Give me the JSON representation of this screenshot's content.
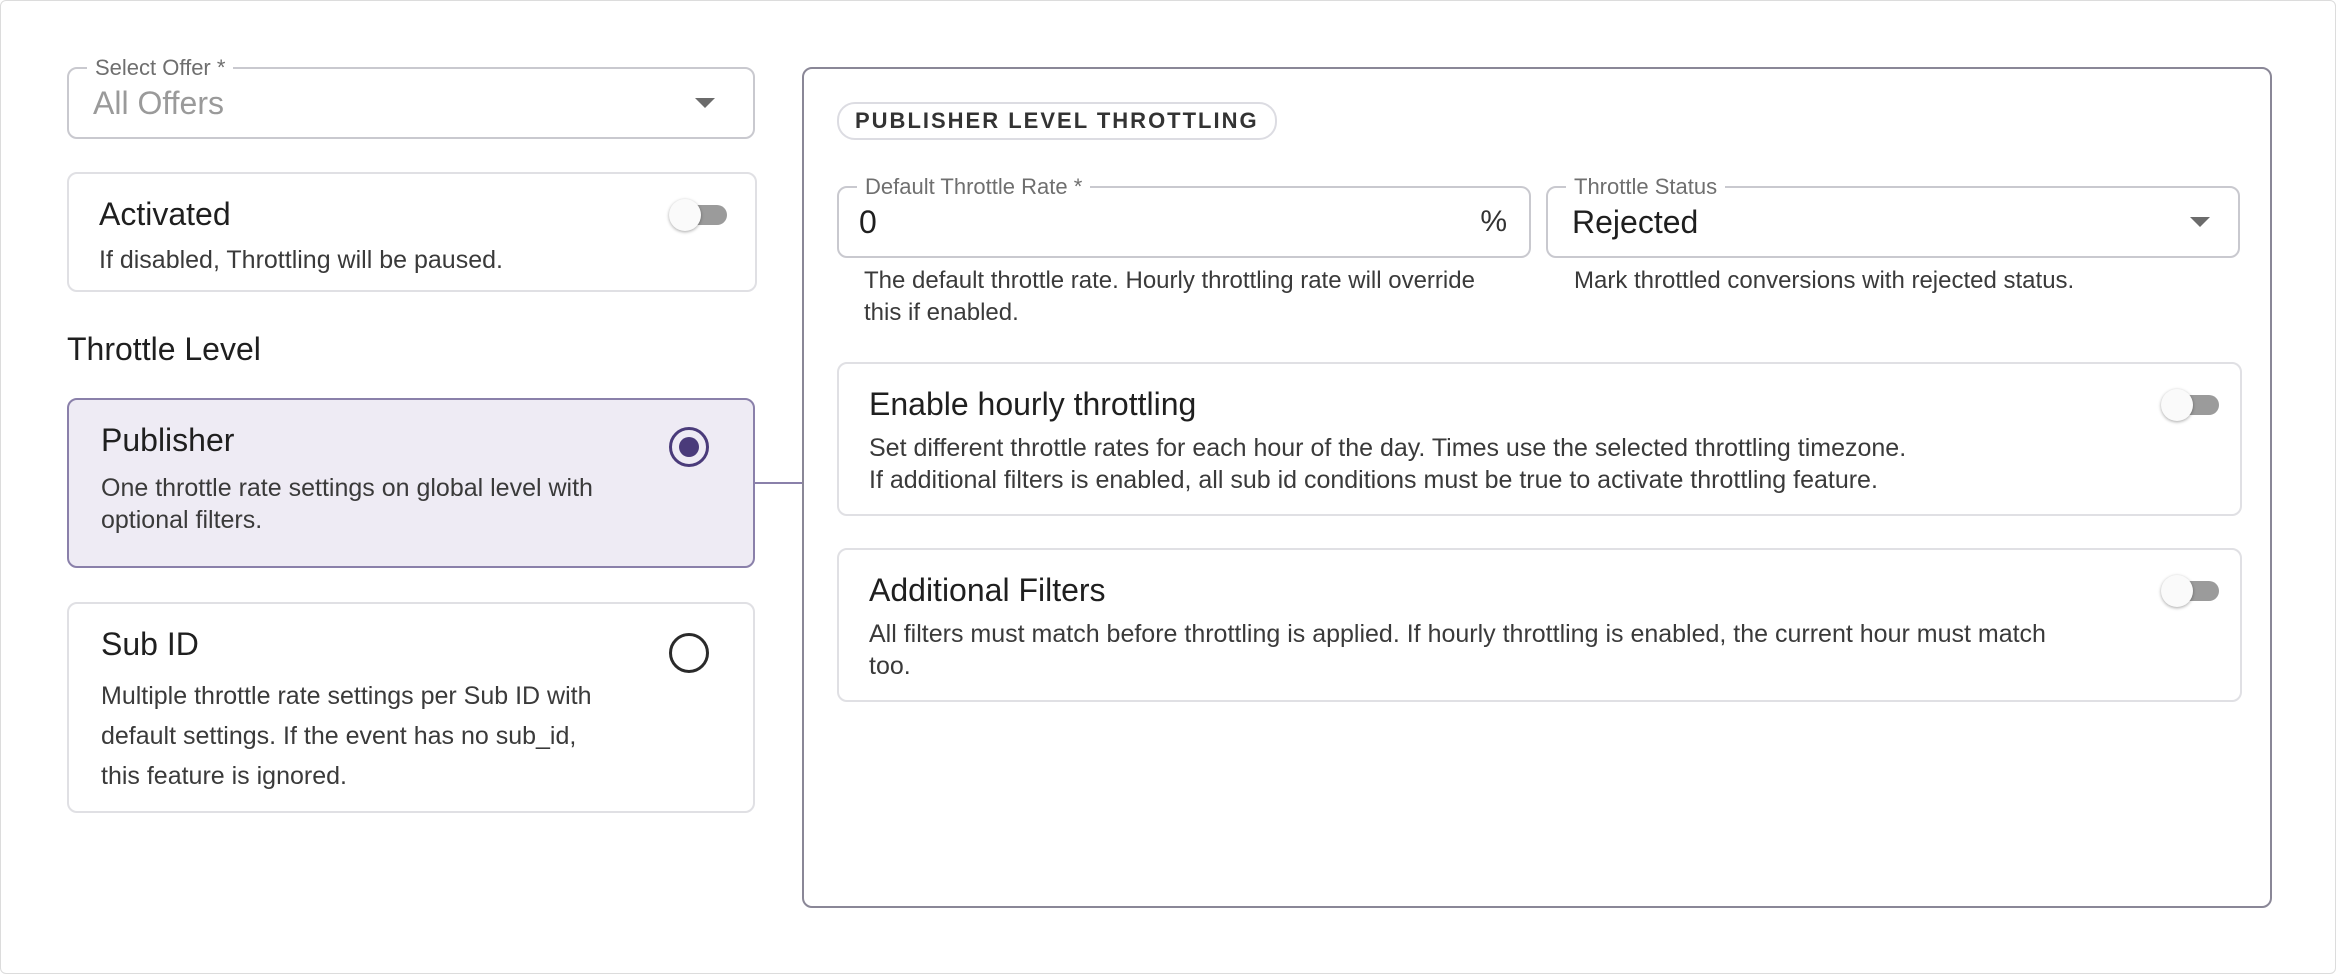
{
  "select_offer": {
    "label": "Select Offer *",
    "value": "All Offers"
  },
  "activated": {
    "title": "Activated",
    "description": "If disabled, Throttling will be paused.",
    "enabled": false
  },
  "throttle_level": {
    "heading": "Throttle Level",
    "options": [
      {
        "title": "Publisher",
        "description": "One throttle rate settings on global level with optional filters.",
        "selected": true
      },
      {
        "title": "Sub ID",
        "description": "Multiple throttle rate settings per Sub ID with default settings. If the event has no sub_id, this feature is ignored.",
        "selected": false
      }
    ]
  },
  "panel": {
    "badge": "PUBLISHER LEVEL THROTTLING",
    "default_rate": {
      "label": "Default Throttle Rate *",
      "value": "0",
      "unit": "%",
      "helper": "The default throttle rate. Hourly throttling rate will override this if enabled."
    },
    "status": {
      "label": "Throttle Status",
      "value": "Rejected",
      "helper": "Mark throttled conversions with rejected status."
    },
    "hourly": {
      "title": "Enable hourly throttling",
      "line1": "Set different throttle rates for each hour of the day. Times use the selected throttling timezone.",
      "line2": "If additional filters is enabled, all sub id conditions must be true to activate throttling feature.",
      "enabled": false
    },
    "filters": {
      "title": "Additional Filters",
      "description": "All filters must match before throttling is applied. If hourly throttling is enabled, the current hour must match too.",
      "enabled": false
    }
  },
  "colors": {
    "accent": "#4a3b7a",
    "selected_bg": "#eeebf4",
    "selected_border": "#8a80aa"
  }
}
